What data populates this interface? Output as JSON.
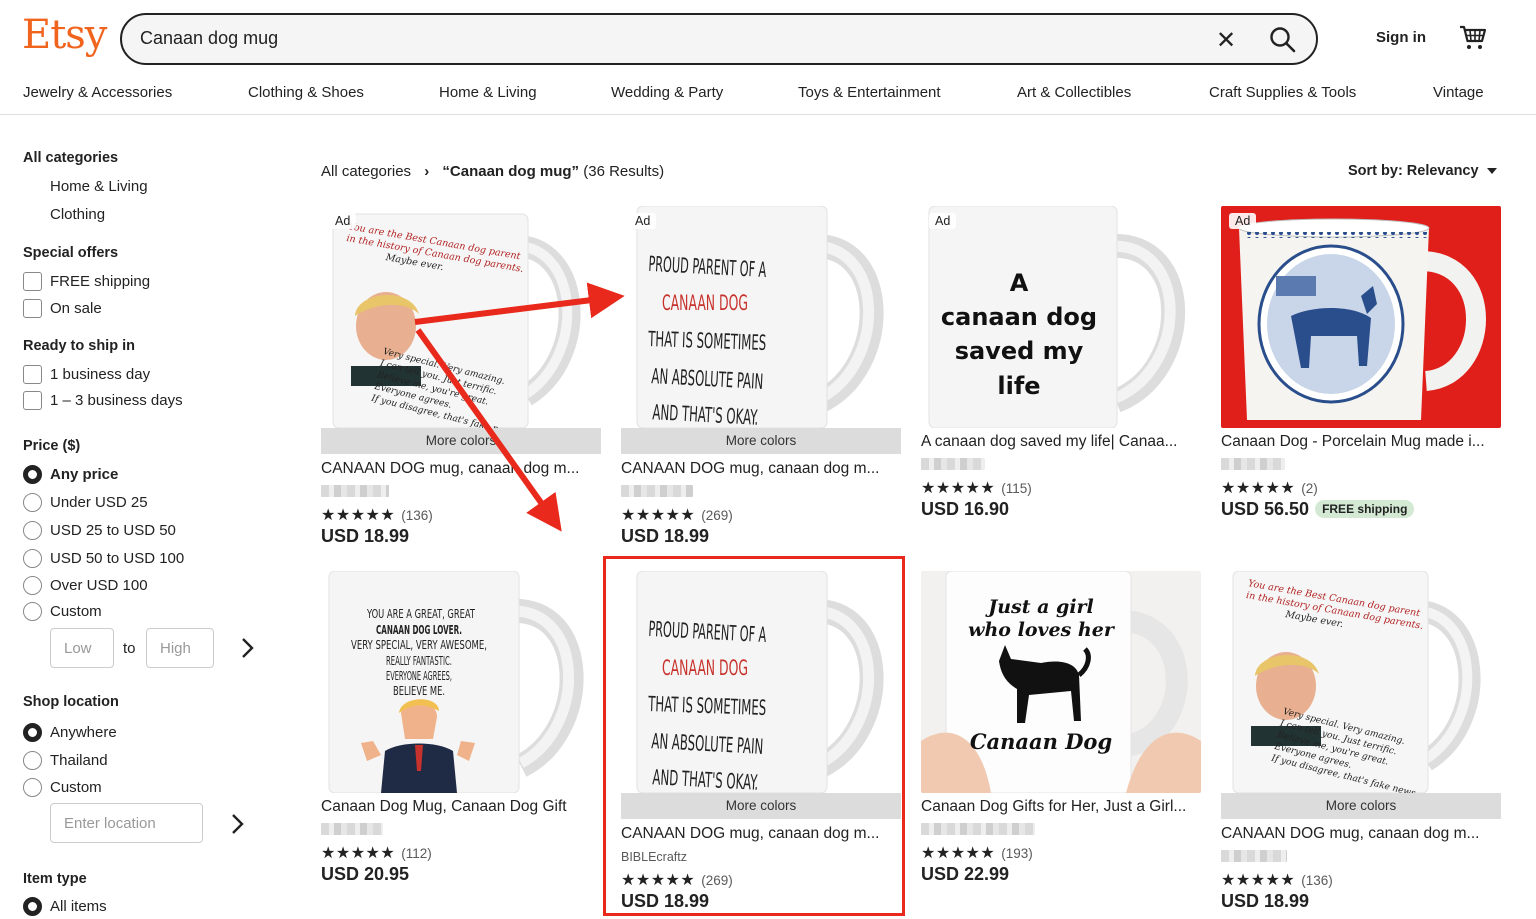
{
  "brand": {
    "logo": "Etsy",
    "color": "#f1641e"
  },
  "search": {
    "value": "Canaan dog mug",
    "clear_icon": "close-icon",
    "search_icon": "search-icon"
  },
  "header": {
    "signin": "Sign in",
    "cart_icon": "cart-icon"
  },
  "categories": [
    "Jewelry & Accessories",
    "Clothing & Shoes",
    "Home & Living",
    "Wedding & Party",
    "Toys & Entertainment",
    "Art & Collectibles",
    "Craft Supplies & Tools",
    "Vintage"
  ],
  "sidebar": {
    "all_categories": "All categories",
    "category_links": [
      "Home & Living",
      "Clothing"
    ],
    "special_offers": {
      "heading": "Special offers",
      "options": [
        "FREE shipping",
        "On sale"
      ]
    },
    "ready_to_ship": {
      "heading": "Ready to ship in",
      "options": [
        "1 business day",
        "1 – 3 business days"
      ]
    },
    "price": {
      "heading": "Price ($)",
      "options": [
        "Any price",
        "Under USD 25",
        "USD 25 to USD 50",
        "USD 50 to USD 100",
        "Over USD 100",
        "Custom"
      ],
      "selected": "Any price",
      "low_placeholder": "Low",
      "to": "to",
      "high_placeholder": "High"
    },
    "shop_location": {
      "heading": "Shop location",
      "options": [
        "Anywhere",
        "Thailand",
        "Custom"
      ],
      "selected": "Anywhere",
      "location_placeholder": "Enter location"
    },
    "item_type": {
      "heading": "Item type",
      "options": [
        "All items"
      ],
      "selected": "All items"
    }
  },
  "breadcrumb": {
    "root": "All categories",
    "separator": "›",
    "query": "“Canaan dog mug”",
    "count": "(36 Results)"
  },
  "sort": {
    "label": "Sort by: Relevancy"
  },
  "listings": [
    {
      "ad": "Ad",
      "more_colors": "More colors",
      "title": "CANAAN DOG mug, canaan dog m...",
      "reviews": "(136)",
      "price": "USD 18.99",
      "stars": "★★★★★",
      "rating": 5
    },
    {
      "ad": "Ad",
      "more_colors": "More colors",
      "title": "CANAAN DOG mug, canaan dog m...",
      "reviews": "(269)",
      "price": "USD 18.99",
      "stars": "★★★★★",
      "rating": 5
    },
    {
      "ad": "Ad",
      "title": "A canaan dog saved my life| Canaa...",
      "reviews": "(115)",
      "price": "USD 16.90",
      "stars": "★★★★★",
      "rating": 4.5
    },
    {
      "ad": "Ad",
      "title": "Canaan Dog - Porcelain Mug made i...",
      "reviews": "(2)",
      "price": "USD 56.50",
      "badge": "FREE shipping",
      "stars": "★★★★★",
      "rating": 5
    },
    {
      "title": "Canaan Dog Mug, Canaan Dog Gift",
      "reviews": "(112)",
      "price": "USD 20.95",
      "stars": "★★★★★",
      "rating": 4.5
    },
    {
      "more_colors": "More colors",
      "title": "CANAAN DOG mug, canaan dog m...",
      "shop": "BIBLEcraftz",
      "reviews": "(269)",
      "price": "USD 18.99",
      "stars": "★★★★★",
      "rating": 5
    },
    {
      "title": "Canaan Dog Gifts for Her, Just a Girl...",
      "reviews": "(193)",
      "price": "USD 22.99",
      "stars": "★★★★★",
      "rating": 5
    },
    {
      "more_colors": "More colors",
      "title": "CANAAN DOG mug, canaan dog m...",
      "reviews": "(136)",
      "price": "USD 18.99",
      "stars": "★★★★★",
      "rating": 5
    }
  ],
  "mug_text": {
    "trump_best": [
      "You are the Best Canaan dog parent",
      "in the history of Canaan dog parents.",
      "Maybe ever."
    ],
    "trump_bottom": [
      "Very special. Very amazing.",
      "I can tell you. Just terrific.",
      "Believe me, you're great.",
      "Everyone agrees.",
      "If you disagree, that's fake news."
    ],
    "proud": [
      "PROUD PARENT OF A",
      "CANAAN DOG",
      "THAT IS SOMETIMES",
      "AN ABSOLUTE PAIN",
      "AND THAT'S OKAY."
    ],
    "saved": [
      "A",
      "canaan dog",
      "saved my",
      "life"
    ],
    "great_lover": [
      "YOU ARE A GREAT, GREAT",
      "CANAAN DOG LOVER.",
      "VERY SPECIAL, VERY AWESOME,",
      "REALLY FANTASTIC.",
      "EVERYONE AGREES,",
      "BELIEVE ME."
    ],
    "girl": [
      "Just a girl",
      "who loves her",
      "Canaan Dog"
    ]
  },
  "colors": {
    "annotation_red": "#e8291c",
    "ad_photo_red": "#e01f1a",
    "accent": "#f1641e",
    "free_badge": "#d4e9d4"
  }
}
